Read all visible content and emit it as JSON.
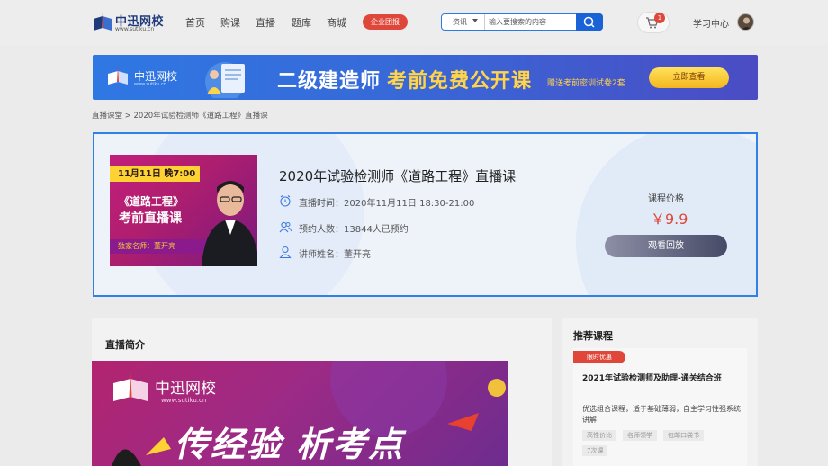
{
  "header": {
    "logo_text": "中迅网校",
    "logo_sub": "www.sutiku.cn",
    "nav": [
      "首页",
      "购课",
      "直播",
      "题库",
      "商城"
    ],
    "enterprise_label": "企业团报",
    "search": {
      "type": "资讯",
      "placeholder": "输入要搜索的内容"
    },
    "cart_count": "1",
    "study_center": "学习中心"
  },
  "banner": {
    "logo_text": "中迅网校",
    "logo_sub": "www.sutiku.cn",
    "title": "二级建造师",
    "title_highlight": "考前免费公开课",
    "subtitle": "赠送考前密训试卷2套",
    "button": "立即查看"
  },
  "breadcrumb": "直播课堂 > 2020年试验检测师《道路工程》直播课",
  "course": {
    "thumb_date": "11月11日 晚7:00",
    "thumb_line1": "《道路工程》",
    "thumb_line2": "考前直播课",
    "thumb_foot": "独家名师：董开亮",
    "title": "2020年试验检测师《道路工程》直播课",
    "live_time": "直播时间：2020年11月11日 18:30-21:00",
    "booked": "预约人数：13844人已预约",
    "teacher": "讲师姓名：董开亮",
    "price_label": "课程价格",
    "price": "￥9.9",
    "replay_button": "观看回放"
  },
  "intro": {
    "title": "直播简介",
    "poster_logo": "中迅网校",
    "poster_sub": "www.sutiku.cn",
    "poster_slogan": "传经验 析考点"
  },
  "recommend": {
    "title": "推荐课程",
    "tag": "限时优惠",
    "name": "2021年试验检测师及助理-通关结合班",
    "desc": "优选组合课程，适于基础薄弱，自主学习性强系统讲解",
    "chips": [
      "高性价比",
      "名师领学",
      "包邮口袋书"
    ],
    "chip2": "7次课"
  },
  "colors": {
    "accent": "#2f80e7",
    "price": "#e0473b",
    "brand": "#1e3a7b"
  }
}
